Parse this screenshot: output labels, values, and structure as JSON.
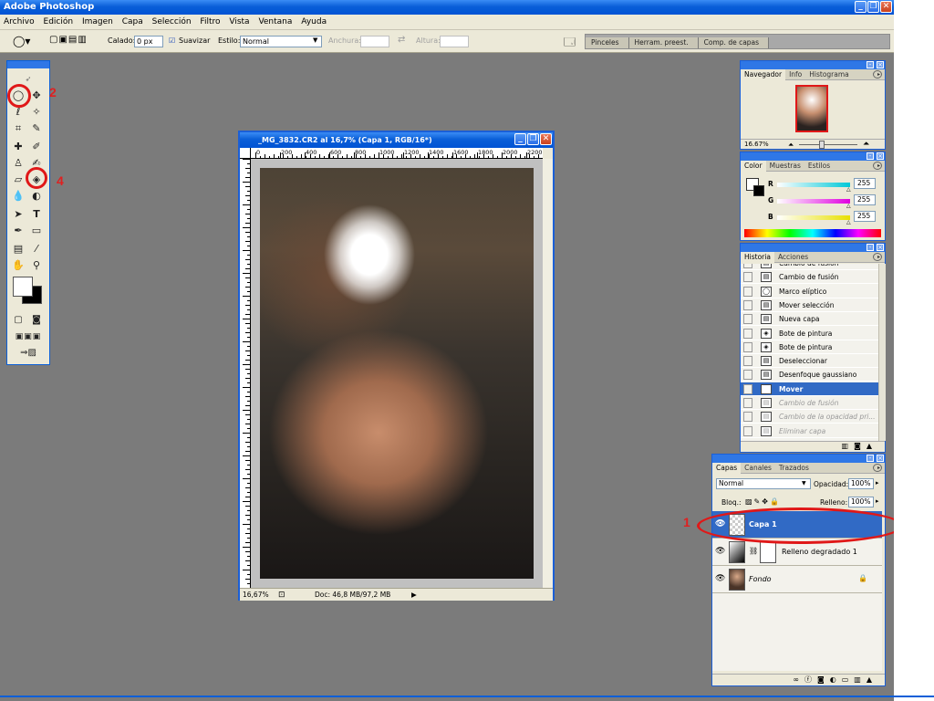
{
  "app": {
    "title": "Adobe Photoshop",
    "title_buttons": [
      "_",
      "❐",
      "✕"
    ]
  },
  "menu": [
    "Archivo",
    "Edición",
    "Imagen",
    "Capa",
    "Selección",
    "Filtro",
    "Vista",
    "Ventana",
    "Ayuda"
  ],
  "options": {
    "feather_label": "Calado:",
    "feather_value": "0 px",
    "antialias_label": "Suavizar",
    "antialias_checked": true,
    "style_label": "Estilo:",
    "style_value": "Normal",
    "width_label": "Anchura:",
    "height_label": "Altura:",
    "well_tabs": [
      "Pinceles",
      "Herram. preest.",
      "Comp. de capas"
    ]
  },
  "document": {
    "title": "_MG_3832.CR2 al 16,7% (Capa 1, RGB/16*)",
    "ruler_top": [
      "0",
      "200",
      "400",
      "600",
      "800",
      "1000",
      "1200",
      "1400",
      "1600",
      "1800",
      "2000",
      "2200"
    ],
    "zoom": "16,67%",
    "doc_size": "Doc: 46,8 MB/97,2 MB"
  },
  "navigator": {
    "tabs": [
      "Navegador",
      "Info",
      "Histograma"
    ],
    "zoom": "16.67%"
  },
  "color": {
    "tabs": [
      "Color",
      "Muestras",
      "Estilos"
    ],
    "channels": [
      {
        "name": "R",
        "value": "255",
        "color": "#00c8d8"
      },
      {
        "name": "G",
        "value": "255",
        "color": "#e000e0"
      },
      {
        "name": "B",
        "value": "255",
        "color": "#e8e000"
      }
    ]
  },
  "history": {
    "tabs": [
      "Historia",
      "Acciones"
    ],
    "items": [
      {
        "label": "Cambio de fusión",
        "state": "normal"
      },
      {
        "label": "Cambio de fusión",
        "state": "normal"
      },
      {
        "label": "Marco elíptico",
        "state": "normal"
      },
      {
        "label": "Mover selección",
        "state": "normal"
      },
      {
        "label": "Nueva capa",
        "state": "normal"
      },
      {
        "label": "Bote de pintura",
        "state": "normal"
      },
      {
        "label": "Bote de pintura",
        "state": "normal"
      },
      {
        "label": "Deseleccionar",
        "state": "normal"
      },
      {
        "label": "Desenfoque gaussiano",
        "state": "normal"
      },
      {
        "label": "Mover",
        "state": "selected"
      },
      {
        "label": "Cambio de fusión",
        "state": "dim"
      },
      {
        "label": "Cambio de la opacidad pri...",
        "state": "dim"
      },
      {
        "label": "Eliminar capa",
        "state": "dim"
      }
    ]
  },
  "layers": {
    "tabs": [
      "Capas",
      "Canales",
      "Trazados"
    ],
    "blend_mode": "Normal",
    "opacity_label": "Opacidad:",
    "opacity": "100%",
    "lock_label": "Bloq.:",
    "fill_label": "Relleno:",
    "fill": "100%",
    "items": [
      {
        "name": "Capa 1",
        "selected": true
      },
      {
        "name": "Relleno degradado 1",
        "selected": false
      },
      {
        "name": "Fondo",
        "selected": false
      }
    ]
  },
  "annotations": [
    "1",
    "2",
    "4"
  ]
}
